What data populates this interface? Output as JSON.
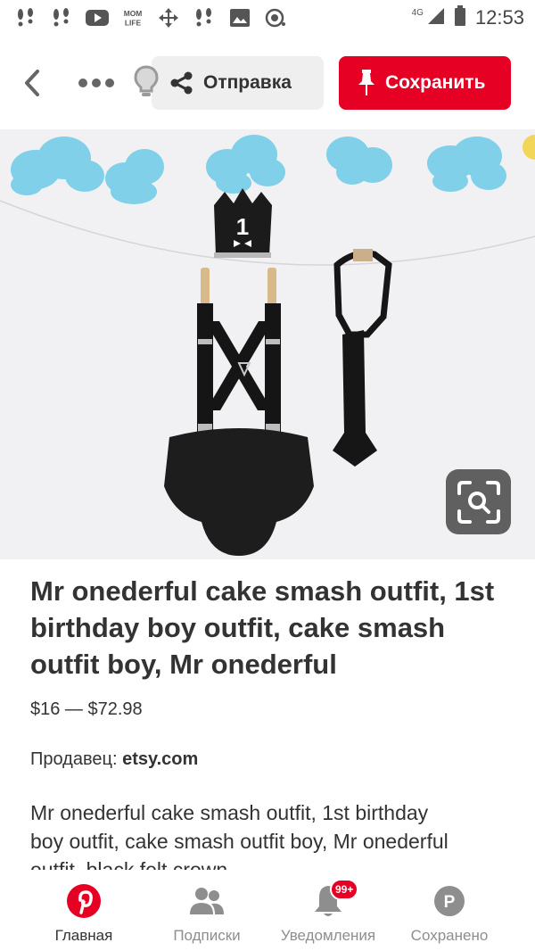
{
  "status_bar": {
    "time": "12:53",
    "network": "4G",
    "mom_life_label": "MOM LIFE"
  },
  "toolbar": {
    "send_label": "Отправка",
    "save_label": "Сохранить"
  },
  "pin": {
    "title": "Mr onederful cake smash outfit, 1st birthday boy outfit, cake smash outfit boy, Mr onederful",
    "price": "$16 — $72.98",
    "seller_label": "Продавец:",
    "seller_name": "etsy.com",
    "description": "Mr onederful cake smash outfit, 1st birthday boy outfit, cake smash outfit boy, Mr onederful outfit, black felt crown",
    "crown_number": "1"
  },
  "bottom_nav": {
    "items": [
      {
        "label": "Главная",
        "icon": "pinterest-logo-icon",
        "active": true
      },
      {
        "label": "Подписки",
        "icon": "people-icon",
        "active": false
      },
      {
        "label": "Уведомления",
        "icon": "bell-icon",
        "active": false,
        "badge": "99+"
      },
      {
        "label": "Сохранено",
        "icon": "profile-p-icon",
        "active": false
      }
    ]
  },
  "colors": {
    "brand_red": "#e60023",
    "send_bg": "#efefef",
    "text": "#333333",
    "muted": "#8e8e8e"
  }
}
